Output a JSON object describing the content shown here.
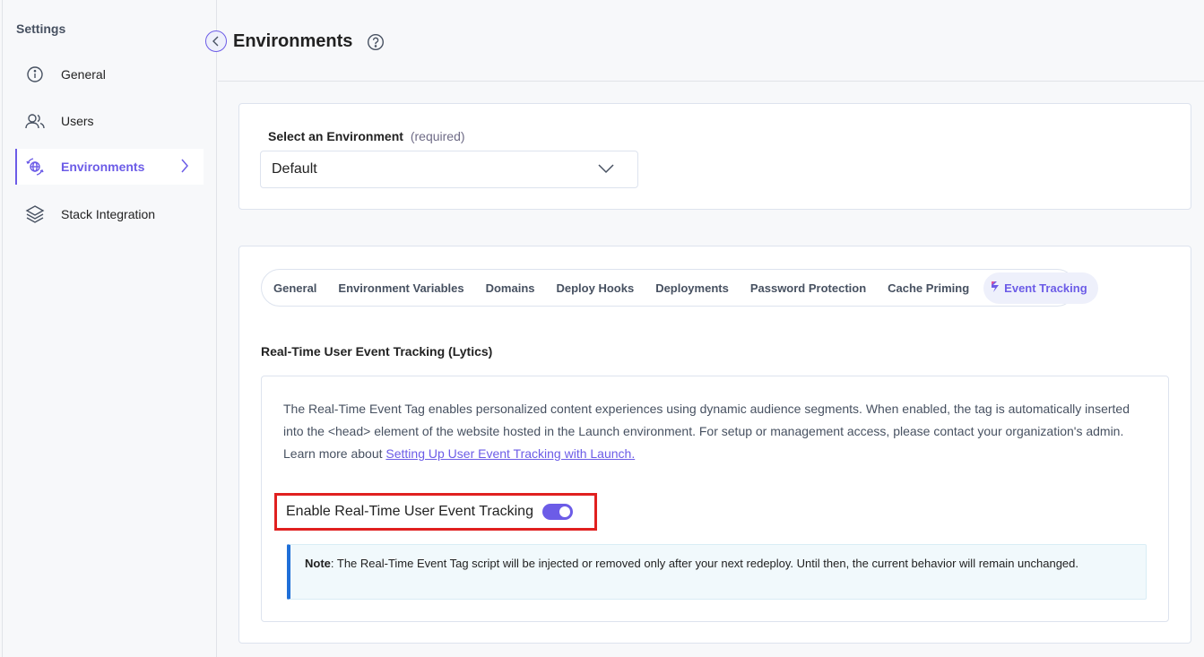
{
  "sidebar": {
    "title": "Settings",
    "items": [
      {
        "label": "General",
        "icon": "info-icon"
      },
      {
        "label": "Users",
        "icon": "users-icon"
      },
      {
        "label": "Environments",
        "icon": "environments-icon"
      },
      {
        "label": "Stack Integration",
        "icon": "layers-icon"
      }
    ],
    "active": "Environments"
  },
  "header": {
    "title": "Environments"
  },
  "environment": {
    "label": "Select an Environment",
    "required": "(required)",
    "selected": "Default"
  },
  "tabs": [
    {
      "label": "General"
    },
    {
      "label": "Environment Variables"
    },
    {
      "label": "Domains"
    },
    {
      "label": "Deploy Hooks"
    },
    {
      "label": "Deployments"
    },
    {
      "label": "Password Protection"
    },
    {
      "label": "Cache Priming"
    },
    {
      "label": "Event Tracking"
    }
  ],
  "active_tab": "Event Tracking",
  "tracking": {
    "section_title": "Real-Time User Event Tracking (Lytics)",
    "description": "The Real-Time Event Tag enables personalized content experiences using dynamic audience segments. When enabled, the tag is automatically inserted into the <head> element of the website hosted in the Launch environment. For setup or management access, please contact your organization's admin. Learn more about ",
    "link_text": "Setting Up User Event Tracking with Launch.",
    "toggle_label": "Enable Real-Time User Event Tracking",
    "toggle_on": true,
    "note_label": "Note",
    "note_text": ": The Real-Time Event Tag script will be injected or removed only after your next redeploy. Until then, the current behavior will remain unchanged."
  },
  "colors": {
    "accent": "#6c5ce7",
    "highlight_border": "#e0201f",
    "note_border": "#1f6fd8"
  }
}
